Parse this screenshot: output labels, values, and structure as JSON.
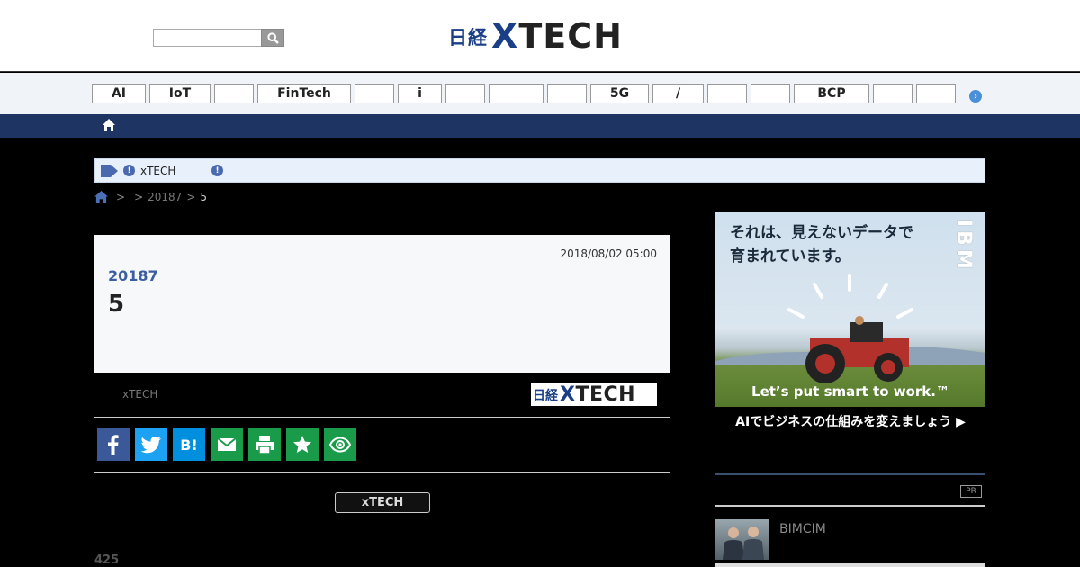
{
  "header": {
    "search_placeholder": "",
    "logo_jp": "日経",
    "logo_x": "X",
    "logo_tech": "TECH"
  },
  "categories": [
    "AI",
    "IoT",
    "",
    "FinTech",
    "",
    "i",
    "",
    "",
    "",
    "5G",
    "/",
    "",
    "",
    "BCP",
    "",
    ""
  ],
  "notice": {
    "text": "xTECH"
  },
  "breadcrumb": {
    "sep1": ">",
    "sep2": ">",
    "level2": "20187",
    "sep3": ">",
    "current": "5"
  },
  "article": {
    "date": "2018/08/02 05:00",
    "kicker": "20187",
    "title": "5",
    "source_label": "xTECH",
    "source_logo_jp": "日経",
    "source_logo_x": "X",
    "source_logo_tech": "TECH"
  },
  "share": {
    "hatena_label": "B!"
  },
  "xtech_button": "xTECH",
  "count": "425",
  "ad": {
    "headline_line1": "それは、見えないデータで",
    "headline_line2": "育まれています。",
    "brand": "IBM",
    "slogan": "Let’s put smart to work.™",
    "cta": "AIでビジネスの仕組みを変えましょう ▶"
  },
  "sidebar": {
    "pr_badge": "PR",
    "item_text": "BIMCIM"
  },
  "colors": {
    "brand_blue": "#1b3f86",
    "nav_dark": "#1e3462",
    "facebook": "#3b5998",
    "twitter": "#1da1f2",
    "hatena": "#008fde",
    "green": "#1a9b4a"
  }
}
